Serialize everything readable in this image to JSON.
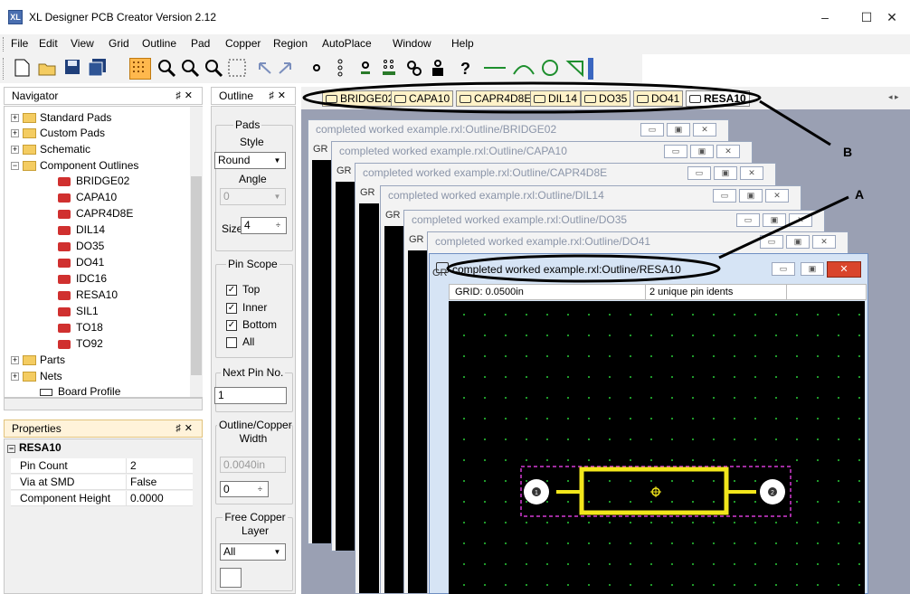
{
  "app": {
    "title": "XL Designer PCB Creator Version 2.12",
    "icon_text": "XL"
  },
  "window_controls": {
    "minimize": "–",
    "maximize": "☐",
    "close": "✕"
  },
  "menu": [
    "File",
    "Edit",
    "View",
    "Grid",
    "Outline",
    "Pad",
    "Copper",
    "Region",
    "AutoPlace",
    "Window",
    "Help"
  ],
  "navigator": {
    "title": "Navigator",
    "pin": "♯",
    "close": "✕",
    "folders": [
      "Standard Pads",
      "Custom Pads",
      "Schematic",
      "Component Outlines"
    ],
    "components": [
      "BRIDGE02",
      "CAPA10",
      "CAPR4D8E",
      "DIL14",
      "DO35",
      "DO41",
      "IDC16",
      "RESA10",
      "SIL1",
      "TO18",
      "TO92"
    ],
    "more": [
      "Parts",
      "Nets",
      "Board Profile"
    ]
  },
  "properties": {
    "title": "Properties",
    "section": "RESA10",
    "rows": [
      {
        "name": "Pin Count",
        "value": "2"
      },
      {
        "name": "Via at SMD",
        "value": "False"
      },
      {
        "name": "Component Height",
        "value": "0.0000"
      }
    ]
  },
  "outline_panel": {
    "title": "Outline",
    "pads_group": "Pads",
    "style_label": "Style",
    "style_value": "Round",
    "angle_label": "Angle",
    "angle_value": "0",
    "size_label": "Size",
    "size_value": "4",
    "pin_scope_group": "Pin Scope",
    "pin_scope": [
      {
        "label": "Top",
        "checked": true
      },
      {
        "label": "Inner",
        "checked": true
      },
      {
        "label": "Bottom",
        "checked": true
      },
      {
        "label": "All",
        "checked": false
      }
    ],
    "next_pin_group": "Next Pin No.",
    "next_pin_value": "1",
    "outline_width_group": "Outline/Copper Width",
    "outline_width_value": "0.0040in",
    "width_spin_value": "0",
    "free_copper_group": "Free Copper Layer",
    "free_copper_value": "All"
  },
  "doc_tabs": [
    "BRIDGE02",
    "CAPA10",
    "CAPR4D8E",
    "DIL14",
    "DO35",
    "DO41",
    "RESA10"
  ],
  "tab_scroll": "◂ ▸",
  "windows": [
    "completed worked example.rxl:Outline/BRIDGE02",
    "completed worked example.rxl:Outline/CAPA10",
    "completed worked example.rxl:Outline/CAPR4D8E",
    "completed worked example.rxl:Outline/DIL14",
    "completed worked example.rxl:Outline/DO35",
    "completed worked example.rxl:Outline/DO41",
    "completed worked example.rxl:Outline/RESA10"
  ],
  "gr_label": "GR",
  "front_status": {
    "grid": "GRID:  0.0500in",
    "pin_idents": "2 unique pin idents"
  },
  "pads": [
    "1",
    "2"
  ],
  "callouts": {
    "a": "A",
    "b": "B"
  }
}
